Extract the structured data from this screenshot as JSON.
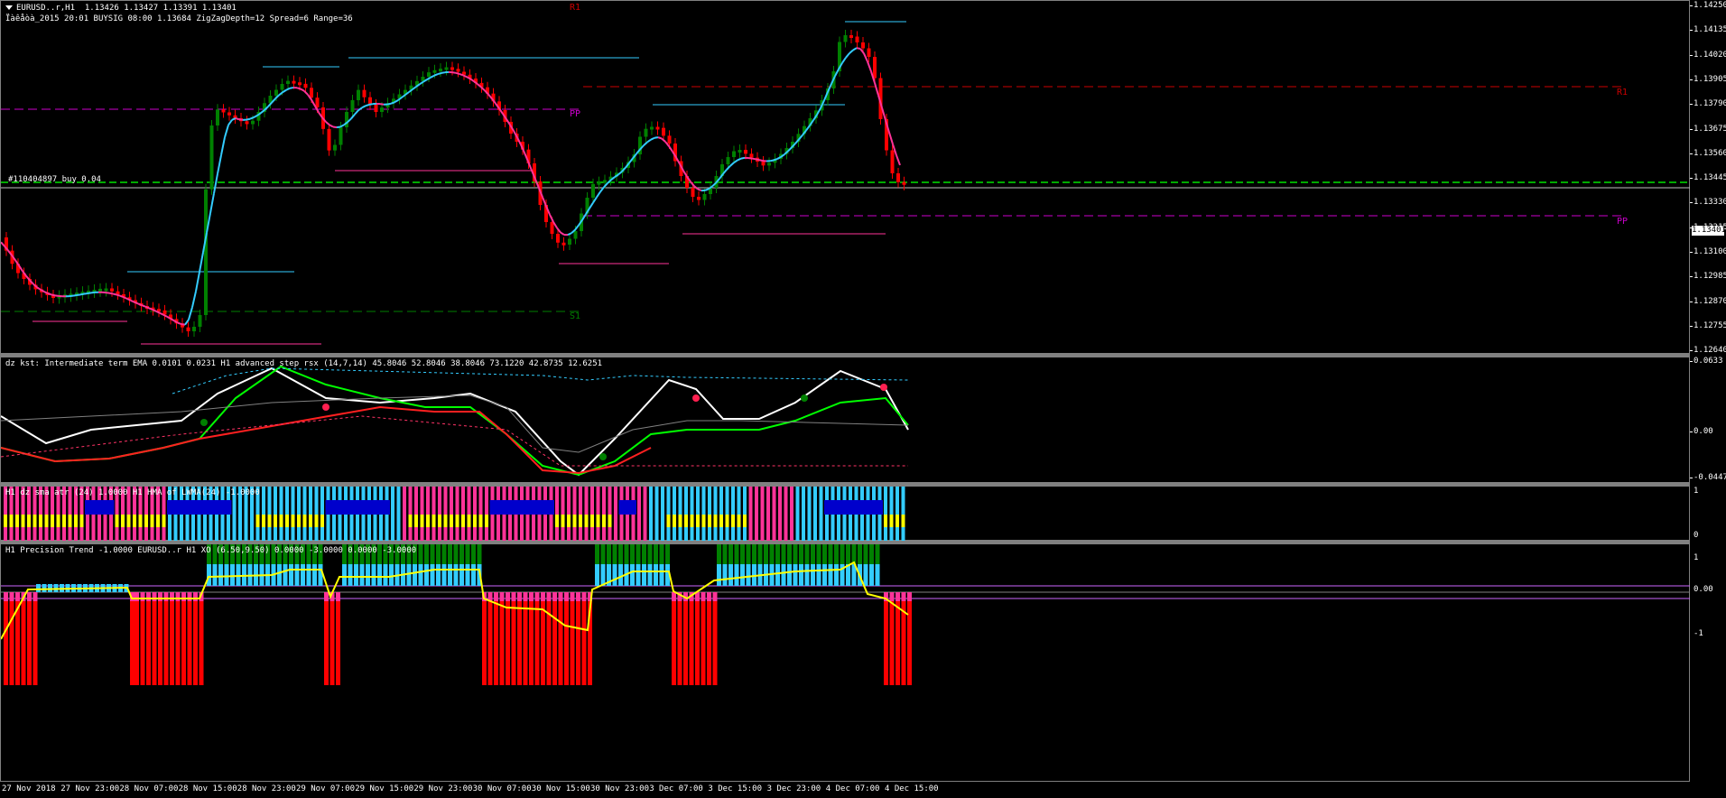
{
  "main": {
    "title_symbol": "EURUSD..r,H1",
    "title_prices": "1.13426 1.13427 1.13391 1.13401",
    "subtitle": "Ïàêåòà_2015  20:01  BUYSIG  08:00  1.13684  ZigZagDepth=12  Spread=6  Range=36",
    "order_label": "#110404897 buy 0.04",
    "levels": {
      "r1": "R1",
      "pp": "PP",
      "s1": "S1"
    },
    "current_price": "1.13401",
    "price_ticks": [
      "1.14250",
      "1.14135",
      "1.14020",
      "1.13905",
      "1.13790",
      "1.13675",
      "1.13560",
      "1.13445",
      "1.13330",
      "1.13215",
      "1.13100",
      "1.12985",
      "1.12870",
      "1.12755",
      "1.12640"
    ]
  },
  "kst": {
    "header": "dz kst: Intermediate term EMA 0.0101 0.0231  H1 advanced step rsx (14,7,14) 45.8046 52.8046 38.8046 73.1220 42.8735 12.6251",
    "ticks": [
      "0.0633",
      "0.00",
      "-0.0447"
    ]
  },
  "sma": {
    "header": "H1 dz sma atr (24) 1.0000  H1 HMA of LWMA(24) -1.0000",
    "ticks": [
      "1",
      "0"
    ]
  },
  "trend": {
    "header": "H1 Precision Trend -1.0000  EURUSD..r H1 XO (6.50,9.50) 0.0000 -3.0000 0.0000 -3.0000",
    "ticks": [
      "1",
      "0.00",
      "-1"
    ]
  },
  "time_axis": [
    "27 Nov 2018",
    "27 Nov 23:00",
    "28 Nov 07:00",
    "28 Nov 15:00",
    "28 Nov 23:00",
    "29 Nov 07:00",
    "29 Nov 15:00",
    "29 Nov 23:00",
    "30 Nov 07:00",
    "30 Nov 15:00",
    "30 Nov 23:00",
    "3 Dec 07:00",
    "3 Dec 15:00",
    "3 Dec 23:00",
    "4 Dec 07:00",
    "4 Dec 15:00"
  ],
  "colors": {
    "bull": "#008000",
    "bear": "#ff0000",
    "ma_up": "#33ccff",
    "ma_down": "#ff3399",
    "pivot_pp": "#cc00cc",
    "pivot_r1": "#cc0000",
    "pivot_s1": "#008000",
    "grid": "#808080"
  }
}
